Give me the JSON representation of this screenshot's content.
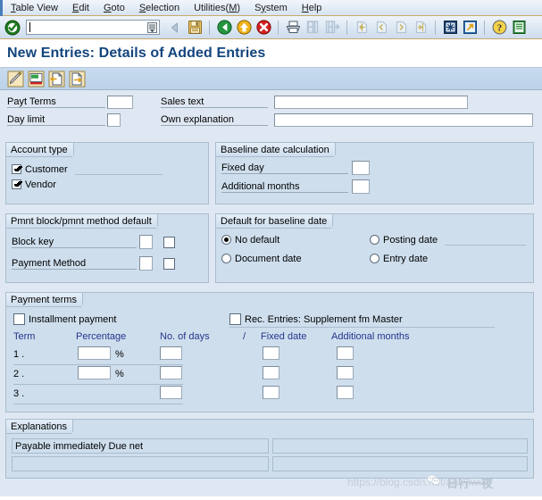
{
  "menubar": {
    "items": [
      {
        "label": "Table View",
        "accel": "T"
      },
      {
        "label": "Edit",
        "accel": "E"
      },
      {
        "label": "Goto",
        "accel": "G"
      },
      {
        "label": "Selection",
        "accel": "S"
      },
      {
        "label": "Utilities(M)",
        "accel": ""
      },
      {
        "label": "System",
        "accel": "y"
      },
      {
        "label": "Help",
        "accel": "H"
      }
    ]
  },
  "toolbar": {
    "command_value": "",
    "command_placeholder": "",
    "icons": [
      {
        "name": "enter-check-icon",
        "title": "Enter"
      },
      {
        "name": "back-arrow-icon",
        "title": "Back"
      },
      {
        "name": "save-icon",
        "title": "Save"
      },
      {
        "name": "back-green-icon",
        "title": "Back"
      },
      {
        "name": "exit-yellow-icon",
        "title": "Exit"
      },
      {
        "name": "cancel-red-icon",
        "title": "Cancel"
      },
      {
        "name": "print-icon",
        "title": "Print"
      },
      {
        "name": "find-icon",
        "title": "Find"
      },
      {
        "name": "find-next-icon",
        "title": "Find Next"
      },
      {
        "name": "first-page-icon",
        "title": "First Page"
      },
      {
        "name": "previous-page-icon",
        "title": "Previous Page"
      },
      {
        "name": "next-page-icon",
        "title": "Next Page"
      },
      {
        "name": "last-page-icon",
        "title": "Last Page"
      },
      {
        "name": "new-session-icon",
        "title": "Create New Session"
      },
      {
        "name": "shortcut-icon",
        "title": "Create Shortcut"
      },
      {
        "name": "help-icon",
        "title": "Help"
      },
      {
        "name": "layout-menu-icon",
        "title": "Customize Local Layout"
      }
    ]
  },
  "page": {
    "title": "New Entries: Details of Added Entries"
  },
  "apptoolbar": {
    "icons": [
      {
        "name": "display-change-icon",
        "title": "Display/Change"
      },
      {
        "name": "new-entries-icon",
        "title": "New Entries"
      },
      {
        "name": "copy-as-icon",
        "title": "Copy As"
      },
      {
        "name": "paste-icon",
        "title": "Paste"
      }
    ]
  },
  "form": {
    "payt_terms": {
      "label": "Payt Terms",
      "value": ""
    },
    "day_limit": {
      "label": "Day limit",
      "value": ""
    },
    "sales_text": {
      "label": "Sales text",
      "value": ""
    },
    "own_explanation": {
      "label": "Own explanation",
      "value": ""
    }
  },
  "account_type": {
    "title": "Account type",
    "options": [
      {
        "label": "Customer",
        "checked": true
      },
      {
        "label": "Vendor",
        "checked": true
      }
    ]
  },
  "baseline_date_calculation": {
    "title": "Baseline date calculation",
    "fields": [
      {
        "label": "Fixed day",
        "value": ""
      },
      {
        "label": "Additional months",
        "value": ""
      }
    ]
  },
  "pmnt_block": {
    "title": "Pmnt block/pmnt method default",
    "rows": [
      {
        "label": "Block key",
        "value": "",
        "checked": false
      },
      {
        "label": "Payment Method",
        "value": "",
        "checked": false
      }
    ]
  },
  "default_baseline_date": {
    "title": "Default for baseline date",
    "options": [
      {
        "label": "No default",
        "selected": true
      },
      {
        "label": "Posting date",
        "selected": false
      },
      {
        "label": "Document date",
        "selected": false
      },
      {
        "label": "Entry date",
        "selected": false
      }
    ]
  },
  "payment_terms": {
    "title": "Payment terms",
    "installment": {
      "label": "Installment payment",
      "checked": false
    },
    "rec_entries": {
      "label": "Rec. Entries: Supplement fm Master",
      "checked": false
    },
    "columns": [
      "Term",
      "Percentage",
      "No. of days",
      "/",
      "Fixed date",
      "Additional months"
    ],
    "rows": [
      {
        "term": "1 .",
        "percentage": "",
        "percent_symbol": "%",
        "days": "",
        "fixed_date": "",
        "additional_months": "",
        "has_percentage": true
      },
      {
        "term": "2 .",
        "percentage": "",
        "percent_symbol": "%",
        "days": "",
        "fixed_date": "",
        "additional_months": "",
        "has_percentage": true
      },
      {
        "term": "3 .",
        "percentage": "",
        "percent_symbol": "",
        "days": "",
        "fixed_date": "",
        "additional_months": "",
        "has_percentage": false
      }
    ]
  },
  "explanations": {
    "title": "Explanations",
    "rows": [
      {
        "left": "Payable immediately Due net",
        "right": ""
      },
      {
        "left": "",
        "right": ""
      }
    ]
  },
  "watermark": {
    "url": "https://blog.csdn.net/aniwiwi/ii",
    "chinese": "日行一夜"
  },
  "colors": {
    "title_blue": "#13457e",
    "panel_bg": "#cedeed",
    "canvas_bg": "#dfe8f2",
    "header_blue": "#26348c",
    "border": "#a9bccd"
  }
}
